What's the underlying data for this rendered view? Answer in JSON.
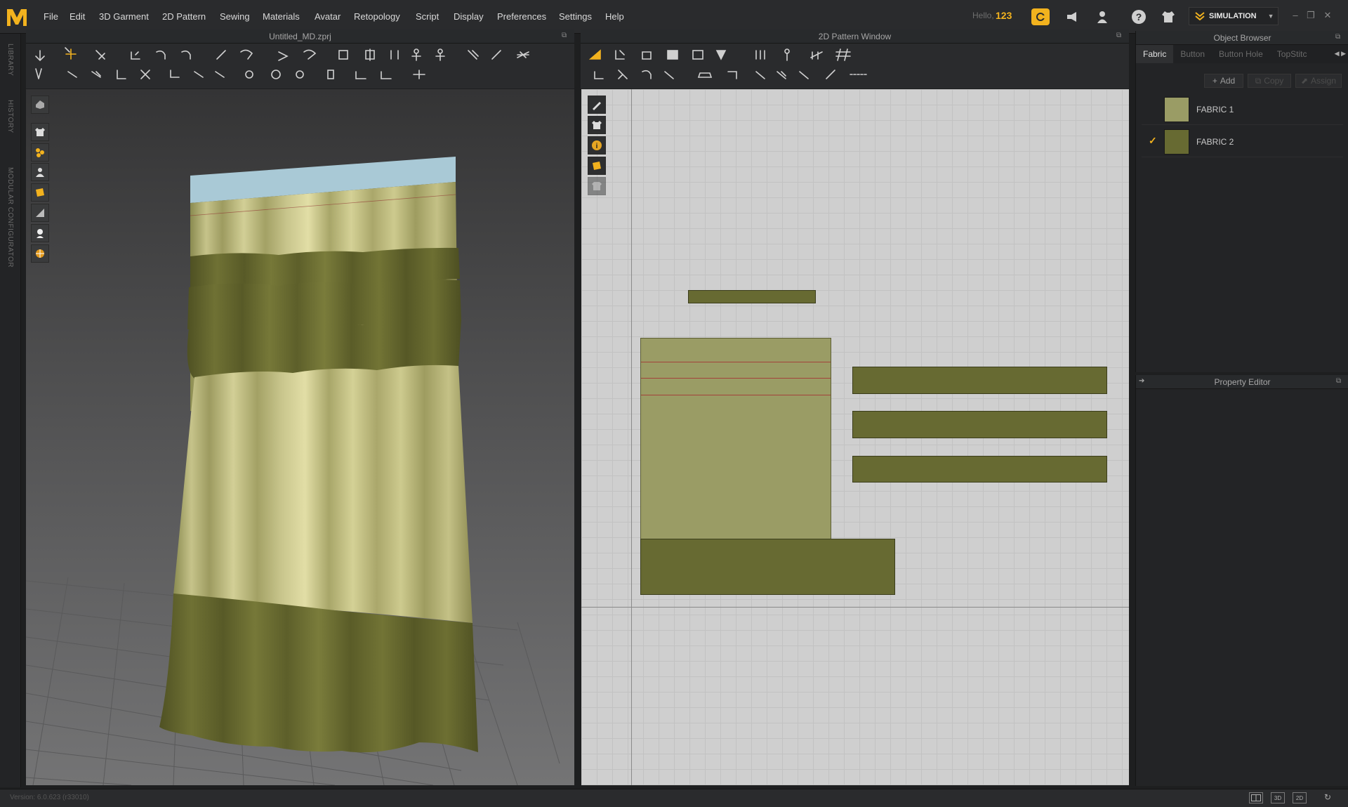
{
  "menu": {
    "items": [
      "File",
      "Edit",
      "3D Garment",
      "2D Pattern",
      "Sewing",
      "Materials",
      "Avatar",
      "Retopology",
      "Script",
      "Display",
      "Preferences",
      "Settings",
      "Help"
    ],
    "hello_label": "Hello,",
    "username": "123",
    "mode_button": "SIMULATION"
  },
  "side_tabs": [
    "LIBRARY",
    "HISTORY",
    "MODULAR CONFIGURATOR"
  ],
  "window_3d": {
    "title": "Untitled_MD.zprj"
  },
  "window_2d": {
    "title": "2D Pattern Window"
  },
  "object_browser": {
    "title": "Object Browser",
    "tabs": [
      {
        "label": "Fabric",
        "active": true
      },
      {
        "label": "Button",
        "active": false
      },
      {
        "label": "Button Hole",
        "active": false
      },
      {
        "label": "TopStitc",
        "active": false
      }
    ],
    "buttons": {
      "add": "Add",
      "copy": "Copy",
      "assign": "Assign"
    },
    "fabrics": [
      {
        "name": "FABRIC 1",
        "color": "#9a9c65",
        "checked": false
      },
      {
        "name": "FABRIC 2",
        "color": "#676a32",
        "checked": true
      }
    ]
  },
  "property_editor": {
    "title": "Property Editor"
  },
  "status": {
    "version": "Version: 6.0.623 (r33010)"
  },
  "view_modes": [
    "",
    "3D",
    "2D"
  ],
  "colors": {
    "accent": "#f2b21e",
    "fabric_light": "#9a9c65",
    "fabric_dark": "#676a32",
    "header_band": "#a9c9d6"
  }
}
